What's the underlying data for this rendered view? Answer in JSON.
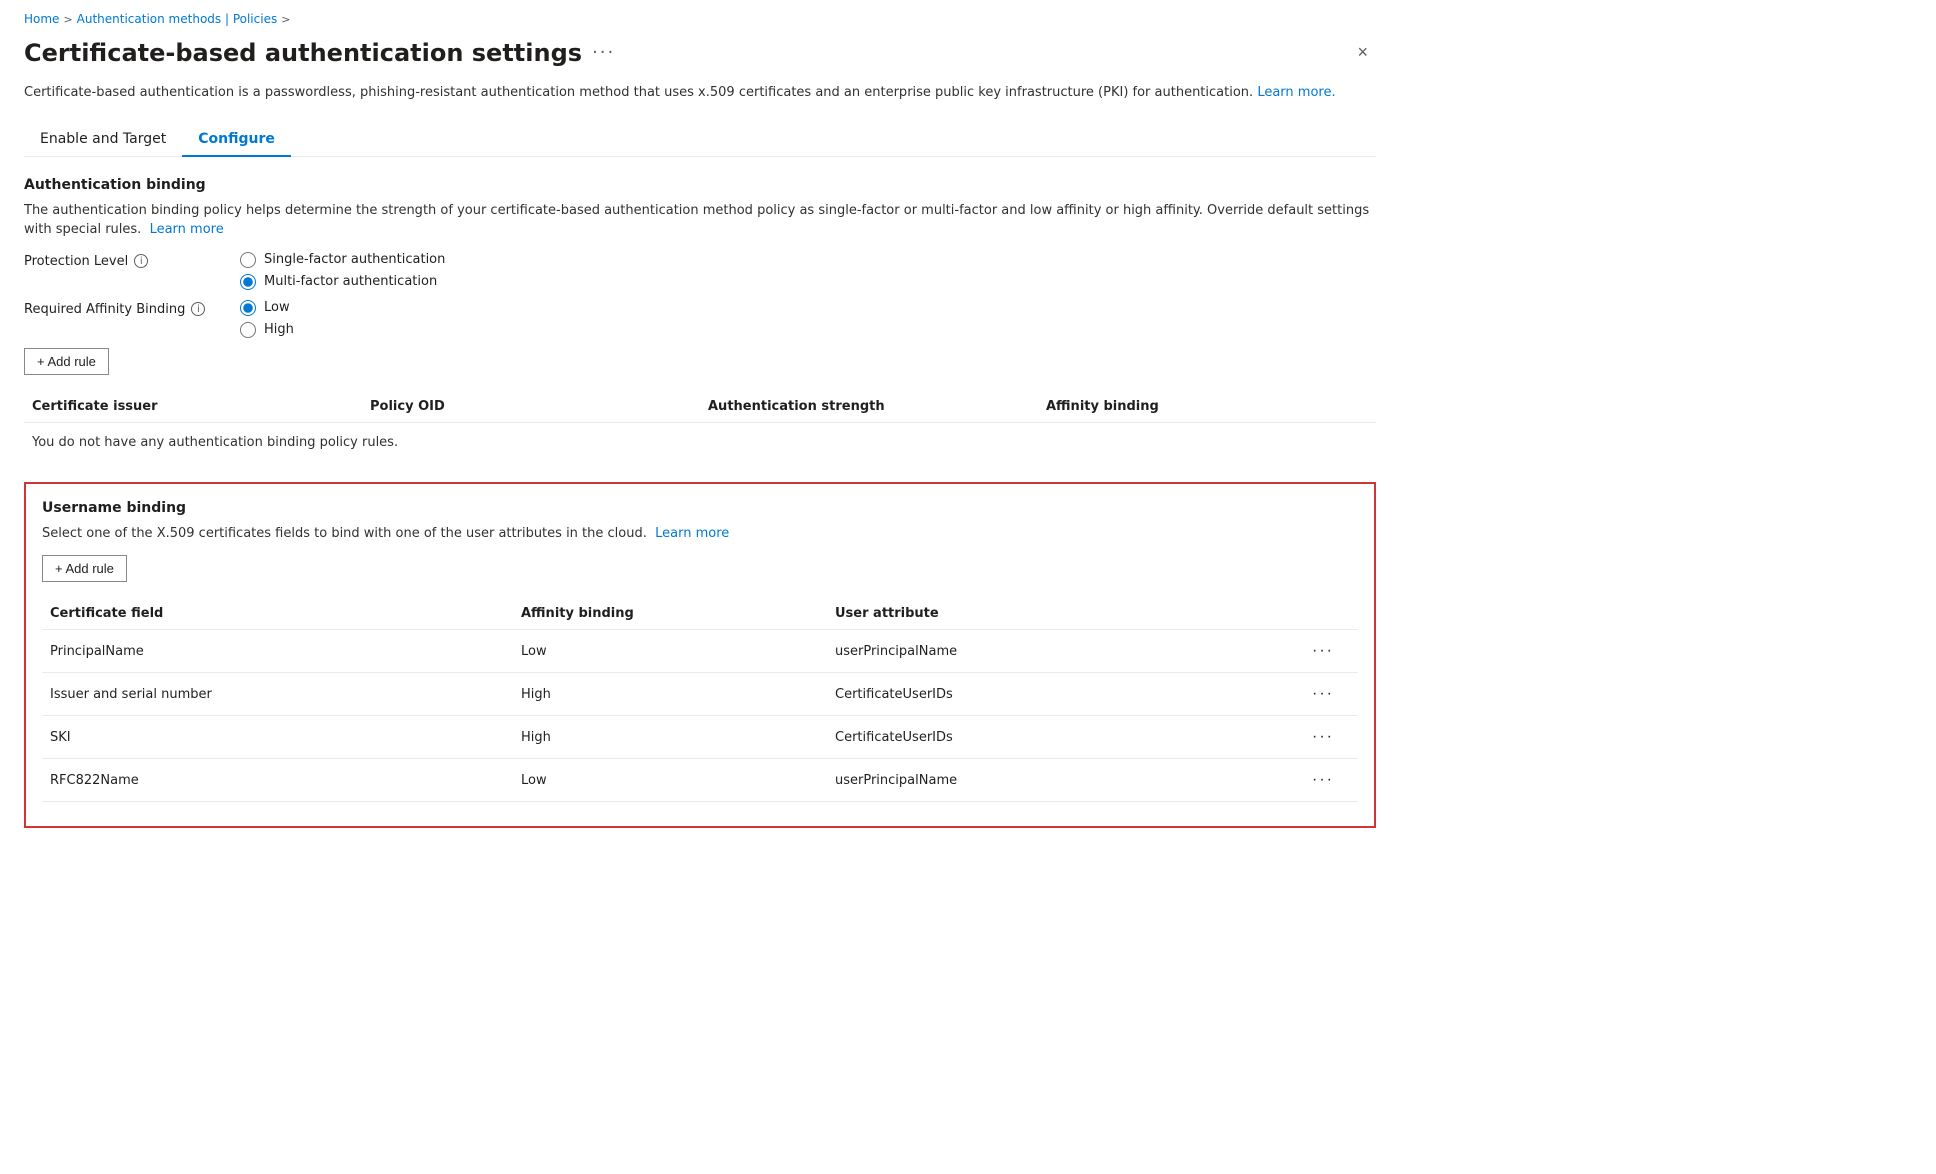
{
  "breadcrumb": {
    "home": "Home",
    "policies": "Authentication methods | Policies",
    "sep1": ">",
    "sep2": ">"
  },
  "page": {
    "title": "Certificate-based authentication settings",
    "more_label": "···",
    "close_label": "×",
    "description": "Certificate-based authentication is a passwordless, phishing-resistant authentication method that uses x.509 certificates and an enterprise public key infrastructure (PKI) for authentication.",
    "learn_more_link": "Learn more."
  },
  "tabs": [
    {
      "id": "enable-target",
      "label": "Enable and Target",
      "active": false
    },
    {
      "id": "configure",
      "label": "Configure",
      "active": true
    }
  ],
  "authentication_binding": {
    "section_title": "Authentication binding",
    "description": "The authentication binding policy helps determine the strength of your certificate-based authentication method policy as single-factor or multi-factor and low affinity or high affinity. Override default settings with special rules.",
    "learn_more": "Learn more",
    "protection_level": {
      "label": "Protection Level",
      "options": [
        {
          "id": "single-factor",
          "label": "Single-factor authentication",
          "checked": false
        },
        {
          "id": "multi-factor",
          "label": "Multi-factor authentication",
          "checked": true
        }
      ]
    },
    "required_affinity": {
      "label": "Required Affinity Binding",
      "options": [
        {
          "id": "low",
          "label": "Low",
          "checked": true
        },
        {
          "id": "high",
          "label": "High",
          "checked": false
        }
      ]
    },
    "add_rule_label": "+ Add rule",
    "table": {
      "columns": [
        "Certificate issuer",
        "Policy OID",
        "Authentication strength",
        "Affinity binding"
      ],
      "empty_message": "You do not have any authentication binding policy rules."
    }
  },
  "username_binding": {
    "section_title": "Username binding",
    "description": "Select one of the X.509 certificates fields to bind with one of the user attributes in the cloud.",
    "learn_more": "Learn more",
    "add_rule_label": "+ Add rule",
    "table": {
      "columns": [
        "Certificate field",
        "Affinity binding",
        "User attribute",
        ""
      ],
      "rows": [
        {
          "field": "PrincipalName",
          "affinity": "Low",
          "user_attribute": "userPrincipalName"
        },
        {
          "field": "Issuer and serial number",
          "affinity": "High",
          "user_attribute": "CertificateUserIDs"
        },
        {
          "field": "SKI",
          "affinity": "High",
          "user_attribute": "CertificateUserIDs"
        },
        {
          "field": "RFC822Name",
          "affinity": "Low",
          "user_attribute": "userPrincipalName"
        }
      ]
    }
  },
  "icons": {
    "info": "i",
    "more": "···",
    "plus": "+",
    "close": "✕",
    "chevron": "›"
  }
}
